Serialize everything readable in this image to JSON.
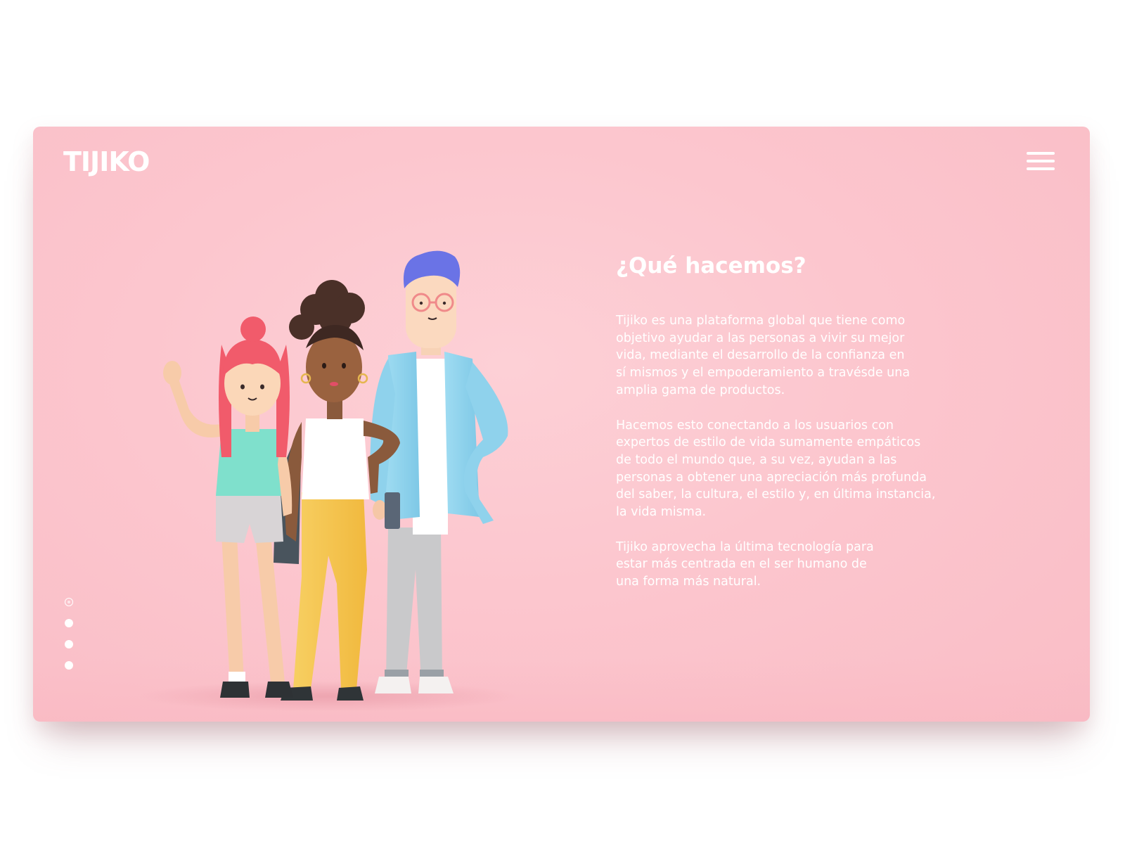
{
  "brand": {
    "logo_text": "TIJIKO"
  },
  "header": {
    "menu_icon": "hamburger-menu-icon"
  },
  "main": {
    "heading": "¿Qué hacemos?",
    "paragraphs": [
      "Tijiko es una plataforma global que tiene como\nobjetivo ayudar a las personas a vivir su mejor\nvida, mediante el desarrollo de la confianza en\nsí mismos y el empoderamiento a travésde una\namplia gama de productos.",
      "Hacemos esto conectando a los usuarios con\nexpertos de estilo de vida sumamente empáticos\nde todo el mundo que, a su vez, ayudan a las\npersonas a obtener una apreciación más profunda\ndel saber, la cultura, el estilo y, en última instancia,\nla vida misma.",
      "Tijiko aprovecha la última tecnología para\nestar más centrada en el ser humano de\nuna forma más natural."
    ]
  },
  "pagination": {
    "count": 4,
    "active_index": 0
  },
  "colors": {
    "background": "#fcc6ce",
    "text": "#ffffff",
    "page": "#ffffff"
  }
}
